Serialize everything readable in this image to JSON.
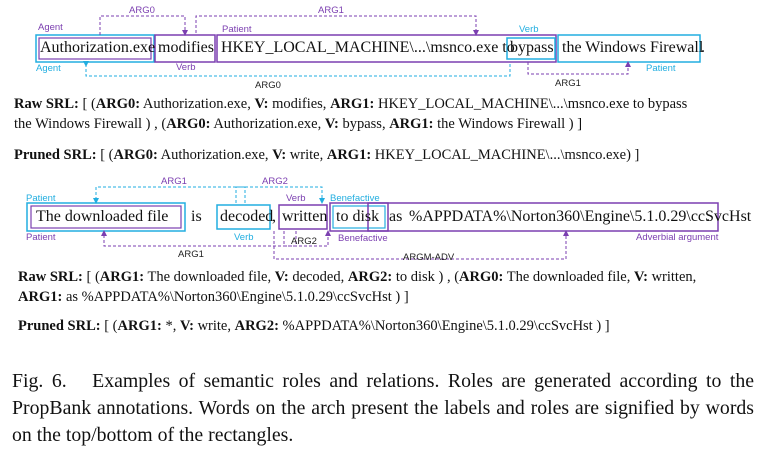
{
  "example1": {
    "words": [
      "Authorization.exe",
      "modifies",
      "HKEY_LOCAL_MACHINE\\...\\msnco.exe to",
      "bypass",
      "the Windows Firewall",
      "."
    ],
    "top_labels": {
      "agent": "Agent",
      "verb": "Verb",
      "patient": "Patient",
      "verb2": "Verb"
    },
    "bottom_labels": {
      "agent": "Agent",
      "verb": "Verb",
      "patient": "Patient"
    },
    "arcs_top": [
      "ARG0",
      "ARG1"
    ],
    "arcs_bottom": [
      "ARG0",
      "ARG1"
    ],
    "raw_srl": {
      "prefix": "Raw SRL:",
      "line1": [
        {
          "t": " [ (",
          "b": false
        },
        {
          "t": "ARG0:",
          "b": true
        },
        {
          "t": " Authorization.exe, ",
          "b": false
        },
        {
          "t": "V:",
          "b": true
        },
        {
          "t": " modifies, ",
          "b": false
        },
        {
          "t": "ARG1:",
          "b": true
        },
        {
          "t": " HKEY_LOCAL_MACHINE\\...\\msnco.exe to bypass",
          "b": false
        }
      ],
      "line2": [
        {
          "t": "the Windows Firewall ) ,  (",
          "b": false
        },
        {
          "t": "ARG0:",
          "b": true
        },
        {
          "t": " Authorization.exe, ",
          "b": false
        },
        {
          "t": "V:",
          "b": true
        },
        {
          "t": " bypass, ",
          "b": false
        },
        {
          "t": "ARG1:",
          "b": true
        },
        {
          "t": " the Windows Firewall ) ]",
          "b": false
        }
      ]
    },
    "pruned_srl": {
      "prefix": "Pruned SRL:",
      "line1": [
        {
          "t": " [ (",
          "b": false
        },
        {
          "t": "ARG0:",
          "b": true
        },
        {
          "t": " Authorization.exe, ",
          "b": false
        },
        {
          "t": "V:",
          "b": true
        },
        {
          "t": " write, ",
          "b": false
        },
        {
          "t": "ARG1:",
          "b": true
        },
        {
          "t": " HKEY_LOCAL_MACHINE\\...\\msnco.exe) ]",
          "b": false
        }
      ]
    }
  },
  "example2": {
    "words": [
      "The downloaded file",
      "is",
      "decoded",
      ",",
      "written",
      "to disk",
      "as",
      "%APPDATA%\\Norton360\\Engine\\5.1.0.29\\ccSvcHst",
      "."
    ],
    "top_labels": {
      "patient": "Patient",
      "verb": "Verb",
      "benefactive": "Benefactive"
    },
    "bottom_labels": {
      "patient": "Patient",
      "verb": "Verb",
      "benefactive": "Benefactive",
      "adverbial": "Adverbial argument"
    },
    "arcs_top": [
      "ARG1",
      "ARG2"
    ],
    "arcs_bottom": [
      "ARG1",
      "ARG2",
      "ARGM-ADV"
    ],
    "raw_srl": {
      "prefix": "Raw SRL:",
      "line1": [
        {
          "t": " [ (",
          "b": false
        },
        {
          "t": "ARG1:",
          "b": true
        },
        {
          "t": " The downloaded file, ",
          "b": false
        },
        {
          "t": "V:",
          "b": true
        },
        {
          "t": " decoded, ",
          "b": false
        },
        {
          "t": "ARG2:",
          "b": true
        },
        {
          "t": " to disk ) , (",
          "b": false
        },
        {
          "t": "ARG0:",
          "b": true
        },
        {
          "t": " The downloaded file, ",
          "b": false
        },
        {
          "t": "V:",
          "b": true
        },
        {
          "t": " written,",
          "b": false
        }
      ],
      "line2": [
        {
          "t": "ARG1:",
          "b": true
        },
        {
          "t": " as %APPDATA%\\Norton360\\Engine\\5.1.0.29\\ccSvcHst ) ]",
          "b": false
        }
      ]
    },
    "pruned_srl": {
      "prefix": "Pruned SRL:",
      "line1": [
        {
          "t": " [ (",
          "b": false
        },
        {
          "t": "ARG1:",
          "b": true
        },
        {
          "t": " *, ",
          "b": false
        },
        {
          "t": "V:",
          "b": true
        },
        {
          "t": " write, ",
          "b": false
        },
        {
          "t": "ARG2:",
          "b": true
        },
        {
          "t": " %APPDATA%\\Norton360\\Engine\\5.1.0.29\\ccSvcHst ) ]",
          "b": false
        }
      ]
    }
  },
  "caption": {
    "label": "Fig. 6.",
    "text": "Examples of semantic roles and relations. Roles are generated according to the PropBank annotations. Words on the arch present the labels and roles are signified by words on the top/bottom of the rectangles."
  },
  "colors": {
    "purple": "#7b3fb0",
    "cyan": "#22aee0",
    "text": "#111111"
  }
}
